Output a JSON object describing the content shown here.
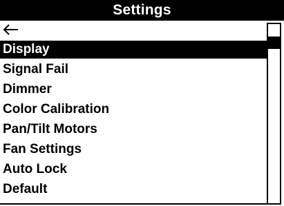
{
  "header": {
    "title": "Settings"
  },
  "menu": {
    "back_icon": "arrow-left-icon",
    "items": [
      {
        "label": "Display",
        "selected": true
      },
      {
        "label": "Signal Fail",
        "selected": false
      },
      {
        "label": "Dimmer",
        "selected": false
      },
      {
        "label": "Color Calibration",
        "selected": false
      },
      {
        "label": "Pan/Tilt Motors",
        "selected": false
      },
      {
        "label": "Fan Settings",
        "selected": false
      },
      {
        "label": "Auto Lock",
        "selected": false
      },
      {
        "label": "Default",
        "selected": false
      }
    ]
  },
  "colors": {
    "background": "#ffffff",
    "foreground": "#000000",
    "highlight_background": "#000000",
    "highlight_text": "#ffffff"
  }
}
